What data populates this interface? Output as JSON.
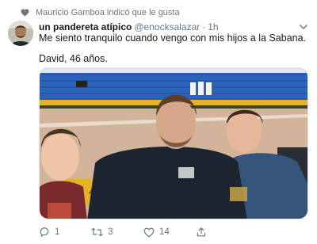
{
  "social_context": {
    "icon": "heart-icon",
    "text": "Mauricio Gamboa indicó que le gusta"
  },
  "tweet": {
    "display_name": "un pandereta atípico",
    "handle": "@enocksalazar",
    "separator": "·",
    "time": "1h",
    "text_line1": "Me siento tranquilo cuando vengo con mis hijos a la Sabana.",
    "text_line2": "David, 46 años.",
    "media": {
      "type": "photo"
    }
  },
  "actions": {
    "reply": {
      "icon": "reply-icon",
      "count": "1"
    },
    "retweet": {
      "icon": "retweet-icon",
      "count": "3"
    },
    "like": {
      "icon": "heart-outline-icon",
      "count": "14"
    },
    "share": {
      "icon": "share-icon"
    }
  },
  "colors": {
    "secondary_text": "#657786",
    "primary_text": "#14171a",
    "stadium_blue": "#2a63b8",
    "stadium_yellow": "#e4b32a"
  }
}
